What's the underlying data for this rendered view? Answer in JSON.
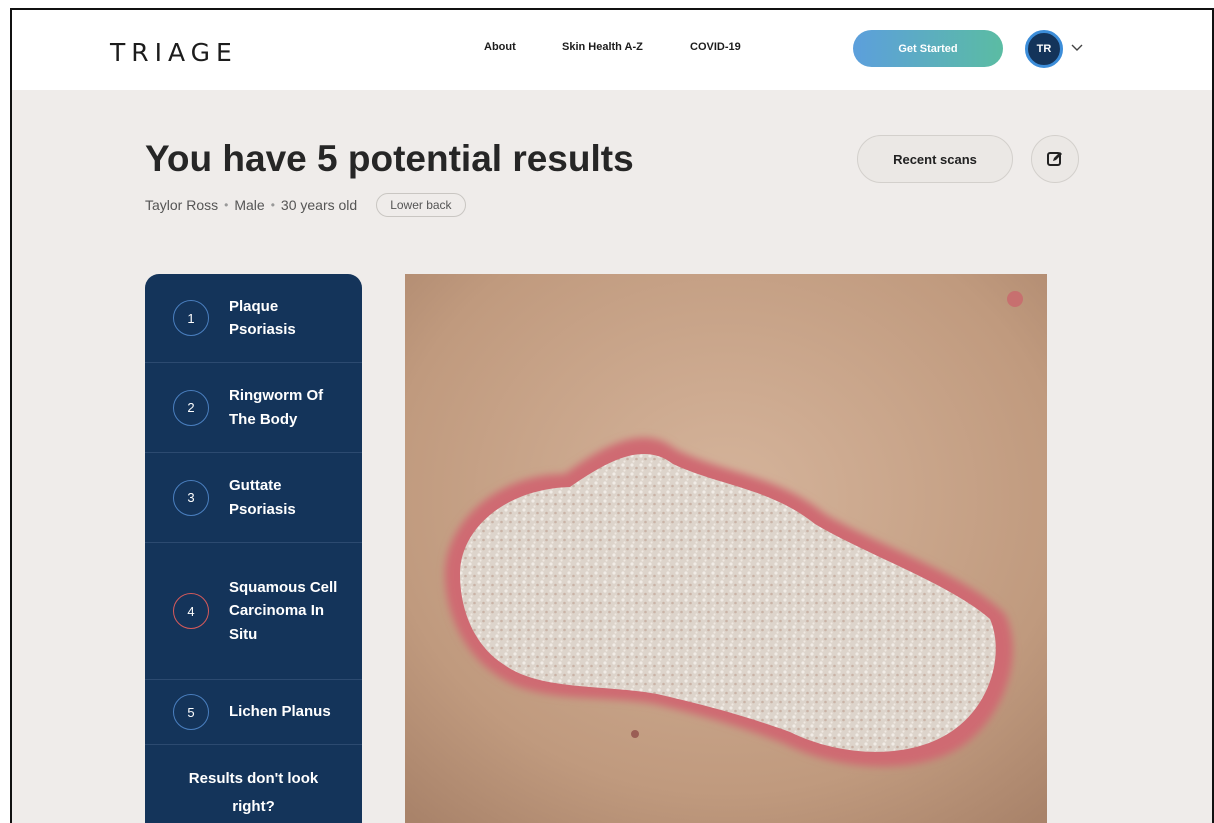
{
  "header": {
    "logo": "TRIAGE",
    "nav": [
      "About",
      "Skin Health A-Z",
      "COVID-19"
    ],
    "cta": "Get Started",
    "avatar_initials": "TR"
  },
  "main": {
    "title": "You have 5 potential results",
    "patient_name": "Taylor Ross",
    "sex": "Male",
    "age": "30 years old",
    "body_location": "Lower back",
    "recent_scans": "Recent scans"
  },
  "results": [
    {
      "num": "1",
      "label": "Plaque Psoriasis"
    },
    {
      "num": "2",
      "label": "Ringworm Of The Body"
    },
    {
      "num": "3",
      "label": "Guttate Psoriasis"
    },
    {
      "num": "4",
      "label": "Squamous Cell Carcinoma In Situ"
    },
    {
      "num": "5",
      "label": "Lichen Planus"
    }
  ],
  "help_text": "Results don't look right?",
  "colors": {
    "navy": "#14345a",
    "accent_blue": "#5c9fdc",
    "accent_green": "#5bbca3",
    "highlight_red": "#d65a5a",
    "background": "#efecea"
  },
  "icons": {
    "edit": "edit-icon",
    "chevron": "chevron-down-icon"
  }
}
